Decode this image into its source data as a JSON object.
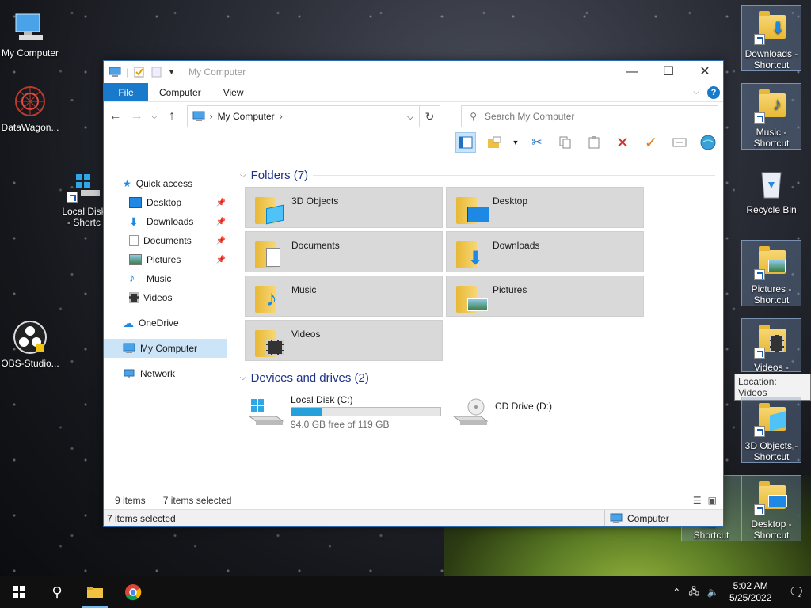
{
  "desktop": {
    "icons_left": [
      {
        "label": "My Computer"
      },
      {
        "label": "DataWagon..."
      },
      {
        "label": "Local Disk - Shortc"
      },
      {
        "label": "OBS-Studio..."
      }
    ],
    "icons_right": [
      {
        "label": "Downloads - Shortcut"
      },
      {
        "label": "Music - Shortcut"
      },
      {
        "label": "Recycle Bin"
      },
      {
        "label": "Pictures - Shortcut"
      },
      {
        "label": "Videos -"
      },
      {
        "label": "3D Objects - Shortcut"
      },
      {
        "label": "Desktop - Shortcut"
      },
      {
        "label": "...ts - Shortcut"
      }
    ],
    "tooltip": "Location: Videos"
  },
  "window": {
    "title": "My Computer",
    "tabs": [
      "File",
      "Computer",
      "View"
    ],
    "address": "My Computer",
    "search_placeholder": "Search My Computer",
    "nav": {
      "quick_access": "Quick access",
      "quick_items": [
        "Desktop",
        "Downloads",
        "Documents",
        "Pictures",
        "Music",
        "Videos"
      ],
      "onedrive": "OneDrive",
      "my_computer": "My Computer",
      "network": "Network"
    },
    "folders_header": "Folders (7)",
    "folders": [
      "3D Objects",
      "Desktop",
      "Documents",
      "Downloads",
      "Music",
      "Pictures",
      "Videos"
    ],
    "drives_header": "Devices and drives (2)",
    "drives": [
      {
        "name": "Local Disk (C:)",
        "free": "94.0 GB free of 119 GB",
        "used_fraction": 0.21
      },
      {
        "name": "CD Drive (D:)"
      }
    ],
    "status": {
      "items": "9 items",
      "selected": "7 items selected"
    },
    "details": {
      "left": "7 items selected",
      "right": "Computer"
    }
  },
  "taskbar": {
    "time": "5:02 AM",
    "date": "5/25/2022"
  },
  "colors": {
    "accent": "#1979ca",
    "selected": "#cce4f7",
    "tile": "#d9d9d9"
  }
}
